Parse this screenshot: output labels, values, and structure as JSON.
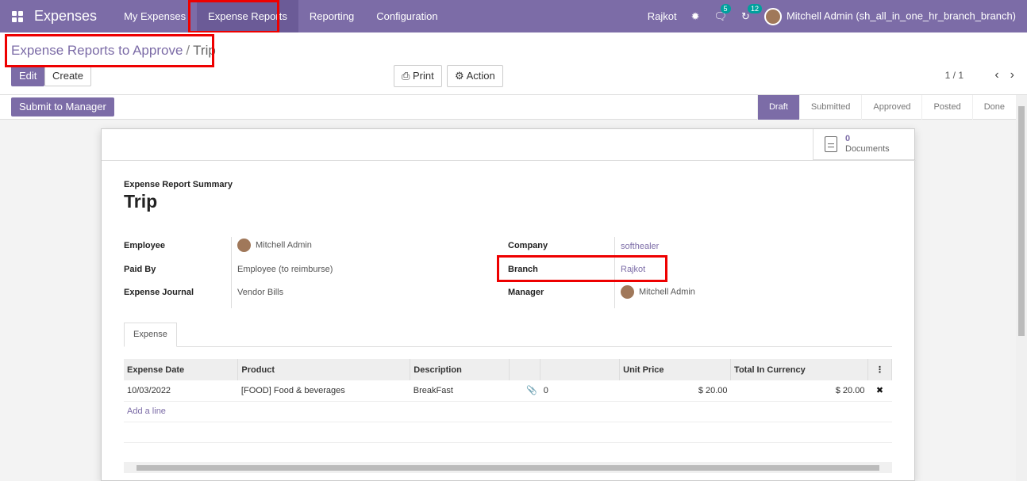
{
  "navbar": {
    "brand": "Expenses",
    "menu": [
      "My Expenses",
      "Expense Reports",
      "Reporting",
      "Configuration"
    ],
    "branch": "Rajkot",
    "chat_count": "5",
    "activity_count": "12",
    "user": "Mitchell Admin (sh_all_in_one_hr_branch_branch)"
  },
  "breadcrumb": {
    "parent": "Expense Reports to Approve",
    "separator": "/",
    "current": "Trip"
  },
  "toolbar": {
    "edit": "Edit",
    "create": "Create",
    "print": "Print",
    "action": "Action",
    "pager": "1 / 1"
  },
  "statusbar": {
    "submit": "Submit to Manager",
    "stages": [
      "Draft",
      "Submitted",
      "Approved",
      "Posted",
      "Done"
    ],
    "active_stage": "Draft"
  },
  "documents": {
    "count": "0",
    "label": "Documents"
  },
  "form": {
    "summary_label": "Expense Report Summary",
    "title": "Trip",
    "left": [
      {
        "label": "Employee",
        "value": "Mitchell Admin"
      },
      {
        "label": "Paid By",
        "value": "Employee (to reimburse)"
      },
      {
        "label": "Expense Journal",
        "value": "Vendor Bills"
      }
    ],
    "right": [
      {
        "label": "Company",
        "value": "softhealer"
      },
      {
        "label": "Branch",
        "value": "Rajkot"
      },
      {
        "label": "Manager",
        "value": "Mitchell Admin"
      }
    ]
  },
  "tab": "Expense",
  "table": {
    "headers": [
      "Expense Date",
      "Product",
      "Description",
      "",
      "",
      "Unit Price",
      "Total In Currency"
    ],
    "rows": [
      {
        "date": "10/03/2022",
        "product": "[FOOD] Food & beverages",
        "description": "BreakFast",
        "attachments": "0",
        "unit_price": "$ 20.00",
        "total": "$ 20.00"
      }
    ],
    "add_line": "Add a line"
  },
  "colors": {
    "brand": "#7c6ca7",
    "highlight": "#e00000"
  }
}
